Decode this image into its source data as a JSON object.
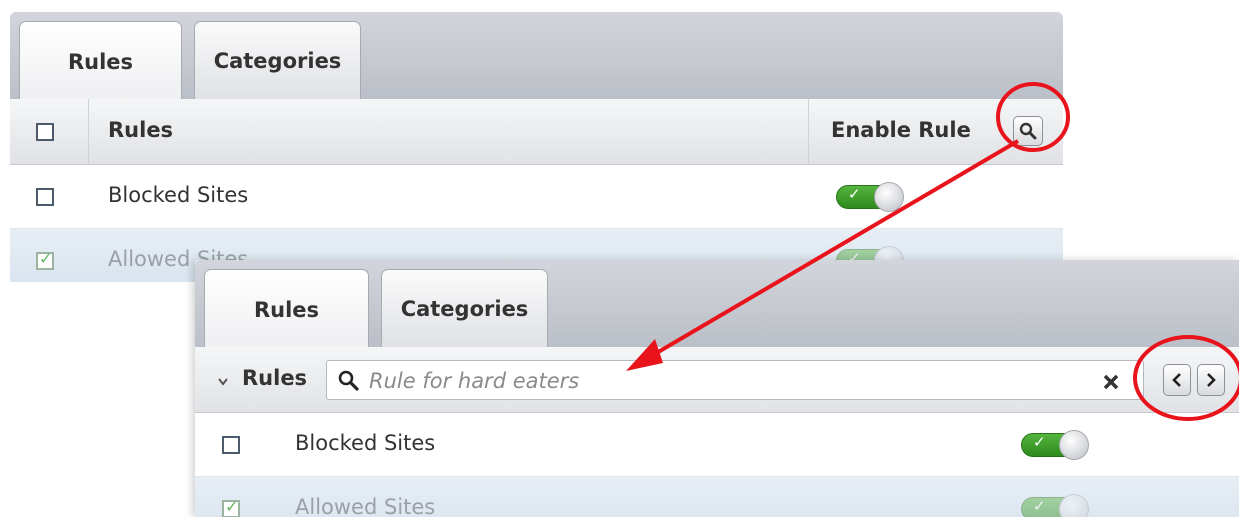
{
  "top_panel": {
    "tabs": [
      {
        "label": "Rules",
        "active": true
      },
      {
        "label": "Categories",
        "active": false
      }
    ],
    "header": {
      "select_all_checked": false,
      "rules_column": "Rules",
      "enable_column": "Enable Rule",
      "search_button_icon": "search-icon"
    },
    "rows": [
      {
        "label": "Blocked Sites",
        "checked": false,
        "enabled": true
      },
      {
        "label": "Allowed Sites",
        "checked": true,
        "enabled": true
      }
    ]
  },
  "bottom_panel": {
    "tabs": [
      {
        "label": "Rules",
        "active": true
      },
      {
        "label": "Categories",
        "active": false
      }
    ],
    "search_bar": {
      "toggle_icon": "chevron-down-icon",
      "label": "Rules",
      "search_icon": "search-icon",
      "placeholder": "Rule for hard eaters",
      "clear_icon": "close-icon",
      "prev_icon": "chevron-left-icon",
      "next_icon": "chevron-right-icon"
    },
    "rows": [
      {
        "label": "Blocked Sites",
        "checked": false,
        "enabled": true
      },
      {
        "label": "Allowed Sites",
        "checked": true,
        "enabled": true
      }
    ]
  },
  "annotation": {
    "highlight_color": "#e8131b",
    "toggle_on_color": "#3fa02a"
  }
}
